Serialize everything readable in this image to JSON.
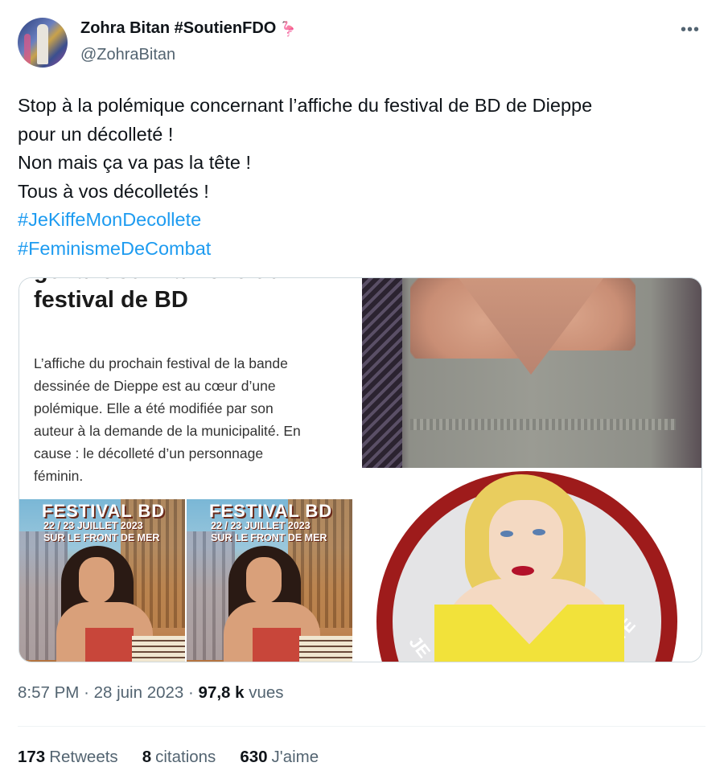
{
  "author": {
    "display_name": "Zohra Bitan #SoutienFDO",
    "emoji": "🦩",
    "handle": "@ZohraBitan"
  },
  "more_icon": "more-dots-icon",
  "tweet": {
    "lines": [
      "Stop à la polémique concernant l’affiche du festival de BD de Dieppe",
      "pour un décolleté !",
      "Non mais ça va pas la tête !",
      "Tous à vos décolletés !"
    ],
    "hashtags": [
      "#JeKiffeMonDecollete",
      "#FeminismeDeCombat"
    ]
  },
  "media": {
    "article": {
      "title_cut": "gênant sur l’affiche du",
      "title": "festival de BD",
      "body_lines": [
        "L’affiche du prochain festival de la bande",
        "dessinée de Dieppe est au cœur d’une",
        "polémique. Elle a été modifiée par son",
        "auteur à la demande de la municipalité. En",
        "cause : le décolleté d’un personnage",
        "féminin."
      ],
      "poster_title": "FESTIVAL BD",
      "poster_date": "22 / 23 JUILLET 2023",
      "poster_place": "SUR LE FRONT DE MER"
    },
    "badge": {
      "left_text": "JE",
      "right_text": "ÉTÉ"
    }
  },
  "meta": {
    "time": "8:57 PM",
    "date": "28 juin 2023",
    "views_count": "97,8 k",
    "views_label": "vues"
  },
  "stats": {
    "retweets_count": "173",
    "retweets_label": "Retweets",
    "quotes_count": "8",
    "quotes_label": "citations",
    "likes_count": "630",
    "likes_label": "J'aime"
  },
  "colors": {
    "link": "#1d9bf0",
    "secondary_text": "#536471",
    "primary_text": "#0f1419"
  }
}
